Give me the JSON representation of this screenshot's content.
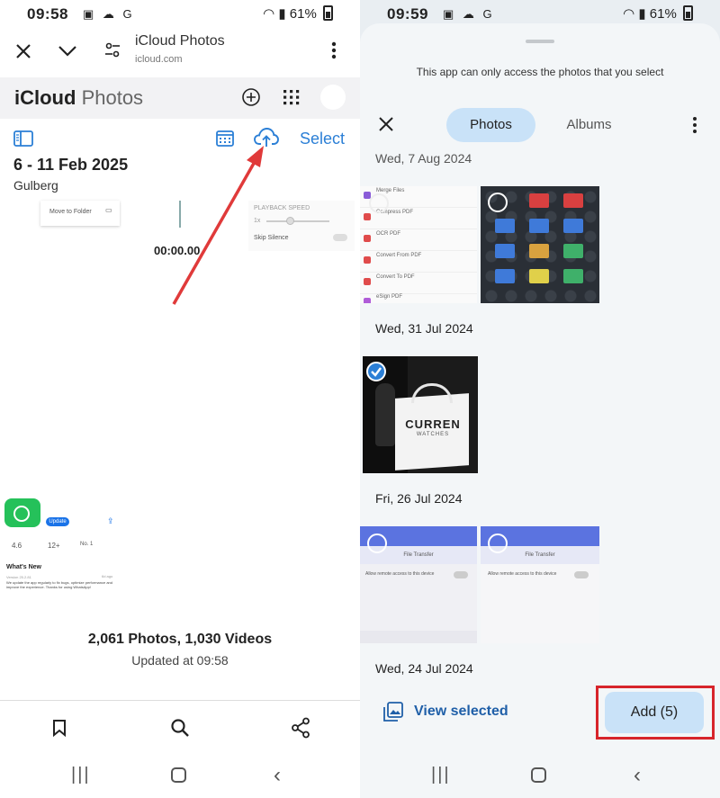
{
  "left": {
    "status": {
      "time": "09:58",
      "icons": "▣ ☁ G",
      "battery": "61%"
    },
    "browser": {
      "tab_title": "iCloud Photos",
      "url": "icloud.com"
    },
    "icloud": {
      "brand": "iCloud",
      "section": "Photos",
      "select_label": "Select",
      "date_range": "6 - 11 Feb 2025",
      "location": "Gulberg"
    },
    "thumb_text": {
      "move_to_folder": "Move to Folder",
      "timer": "00:00.00",
      "playback_speed": "PLAYBACK SPEED",
      "speed_value": "1x",
      "skip_silence": "Skip Silence",
      "update": "Update",
      "whats_new": "What's New",
      "rating": "4.6",
      "age": "12+",
      "rank": "No. 1",
      "version": "Version 25.2.81",
      "time_ago": "6d ago",
      "update_text": "We update the app regularly to fix bugs, optimize performance and improve the experience. Thanks for using WhatsApp!"
    },
    "summary": {
      "counts": "2,061 Photos, 1,030 Videos",
      "updated": "Updated at 09:58"
    }
  },
  "right": {
    "status": {
      "time": "09:59",
      "icons": "▣ ☁ G",
      "battery": "61%"
    },
    "notice": "This app can only access the photos that you select",
    "tabs": {
      "photos": "Photos",
      "albums": "Albums"
    },
    "groups": [
      {
        "date": "Wed, 7 Aug 2024"
      },
      {
        "date": "Wed, 31 Jul 2024"
      },
      {
        "date": "Fri, 26 Jul 2024"
      },
      {
        "date": "Wed, 24 Jul 2024"
      }
    ],
    "pdf_menu": [
      "Merge Files",
      "Compress PDF",
      "OCR PDF",
      "Convert From PDF",
      "Convert To PDF",
      "eSign PDF"
    ],
    "file_transfer": [
      "File Transfer",
      "Allow remote access to this device"
    ],
    "bag_brand": "CURREN",
    "bag_sub": "WATCHES",
    "view_selected": "View selected",
    "add_button": "Add (5)"
  },
  "colors": {
    "accent": "#2b7fd6",
    "highlight": "#d7242b",
    "tab_active": "#c9e2f8"
  }
}
